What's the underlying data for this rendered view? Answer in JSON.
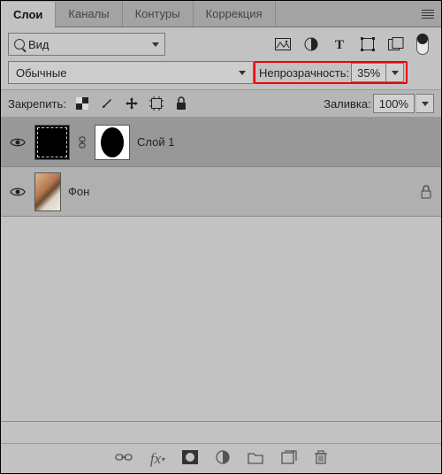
{
  "tabs": {
    "items": [
      "Слои",
      "Каналы",
      "Контуры",
      "Коррекция"
    ],
    "active": 0
  },
  "filter": {
    "label": "Вид"
  },
  "blend": {
    "label": "Обычные"
  },
  "opacity": {
    "label": "Непрозрачность:",
    "value": "35%"
  },
  "lock": {
    "label": "Закрепить:"
  },
  "fill": {
    "label": "Заливка:",
    "value": "100%"
  },
  "layers": [
    {
      "name": "Слой 1",
      "visible": true,
      "hasMask": true,
      "locked": false,
      "active": true
    },
    {
      "name": "Фон",
      "visible": true,
      "hasMask": false,
      "locked": true,
      "active": false
    }
  ]
}
